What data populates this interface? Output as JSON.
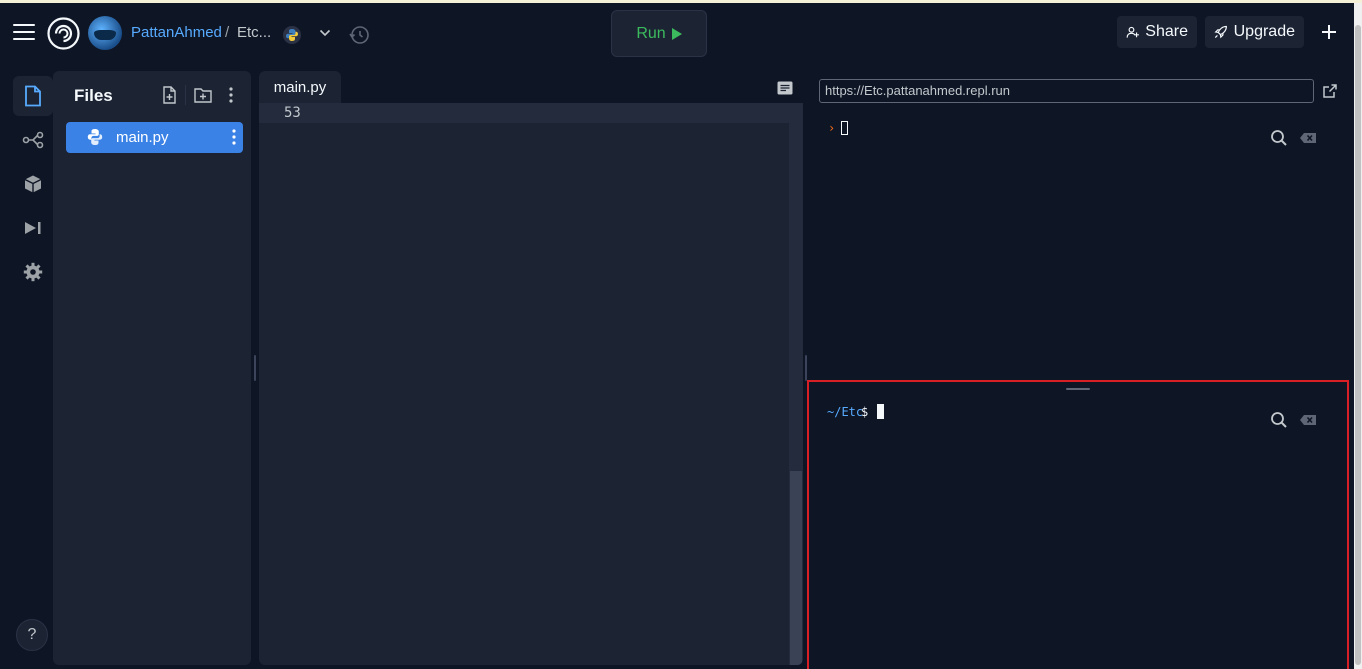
{
  "header": {
    "username": "PattanAhmed",
    "separator": "/",
    "repl_name": "Etc...",
    "run_label": "Run",
    "share_label": "Share",
    "upgrade_label": "Upgrade"
  },
  "files": {
    "title": "Files",
    "items": [
      {
        "name": "main.py"
      }
    ]
  },
  "editor": {
    "tab_label": "main.py",
    "line_number": "53"
  },
  "webview": {
    "url": "https://Etc.pattanahmed.repl.run",
    "prompt_symbol": "›"
  },
  "shell": {
    "path": "~/Etc",
    "prompt": "$"
  },
  "help": {
    "label": "?"
  },
  "colors": {
    "background": "#0e1525",
    "panel": "#1c2333",
    "accent": "#3b82e6",
    "run_green": "#3cbb5e",
    "link_blue": "#57abff",
    "highlight_border": "#d81f26"
  }
}
